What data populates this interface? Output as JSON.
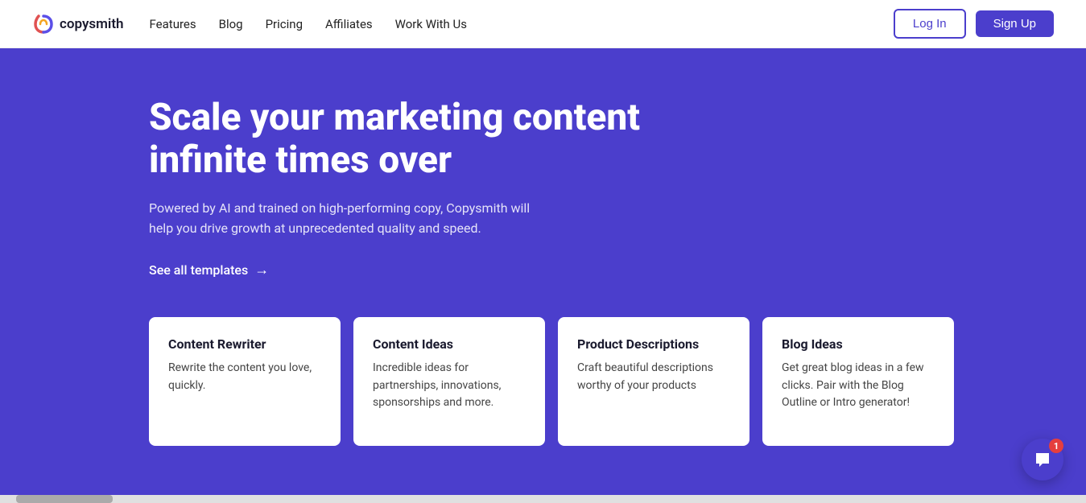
{
  "nav": {
    "brand": "copysmith",
    "links": [
      {
        "label": "Features",
        "id": "features"
      },
      {
        "label": "Blog",
        "id": "blog"
      },
      {
        "label": "Pricing",
        "id": "pricing"
      },
      {
        "label": "Affiliates",
        "id": "affiliates"
      },
      {
        "label": "Work With Us",
        "id": "work-with-us"
      }
    ],
    "login_label": "Log In",
    "signup_label": "Sign Up"
  },
  "hero": {
    "title": "Scale your marketing content infinite times over",
    "subtitle": "Powered by AI and trained on high-performing copy, Copysmith will help you drive growth at unprecedented quality and speed.",
    "cta_label": "See all templates",
    "bg_color": "#4B3ECC"
  },
  "cards": [
    {
      "id": "content-rewriter",
      "title": "Content Rewriter",
      "description": "Rewrite the content you love, quickly."
    },
    {
      "id": "content-ideas",
      "title": "Content Ideas",
      "description": "Incredible ideas for partnerships, innovations, sponsorships and more."
    },
    {
      "id": "product-descriptions",
      "title": "Product Descriptions",
      "description": "Craft beautiful descriptions worthy of your products"
    },
    {
      "id": "blog-ideas",
      "title": "Blog Ideas",
      "description": "Get great blog ideas in a few clicks. Pair with the Blog Outline or Intro generator!"
    }
  ],
  "chat_widget": {
    "badge_count": "1"
  }
}
